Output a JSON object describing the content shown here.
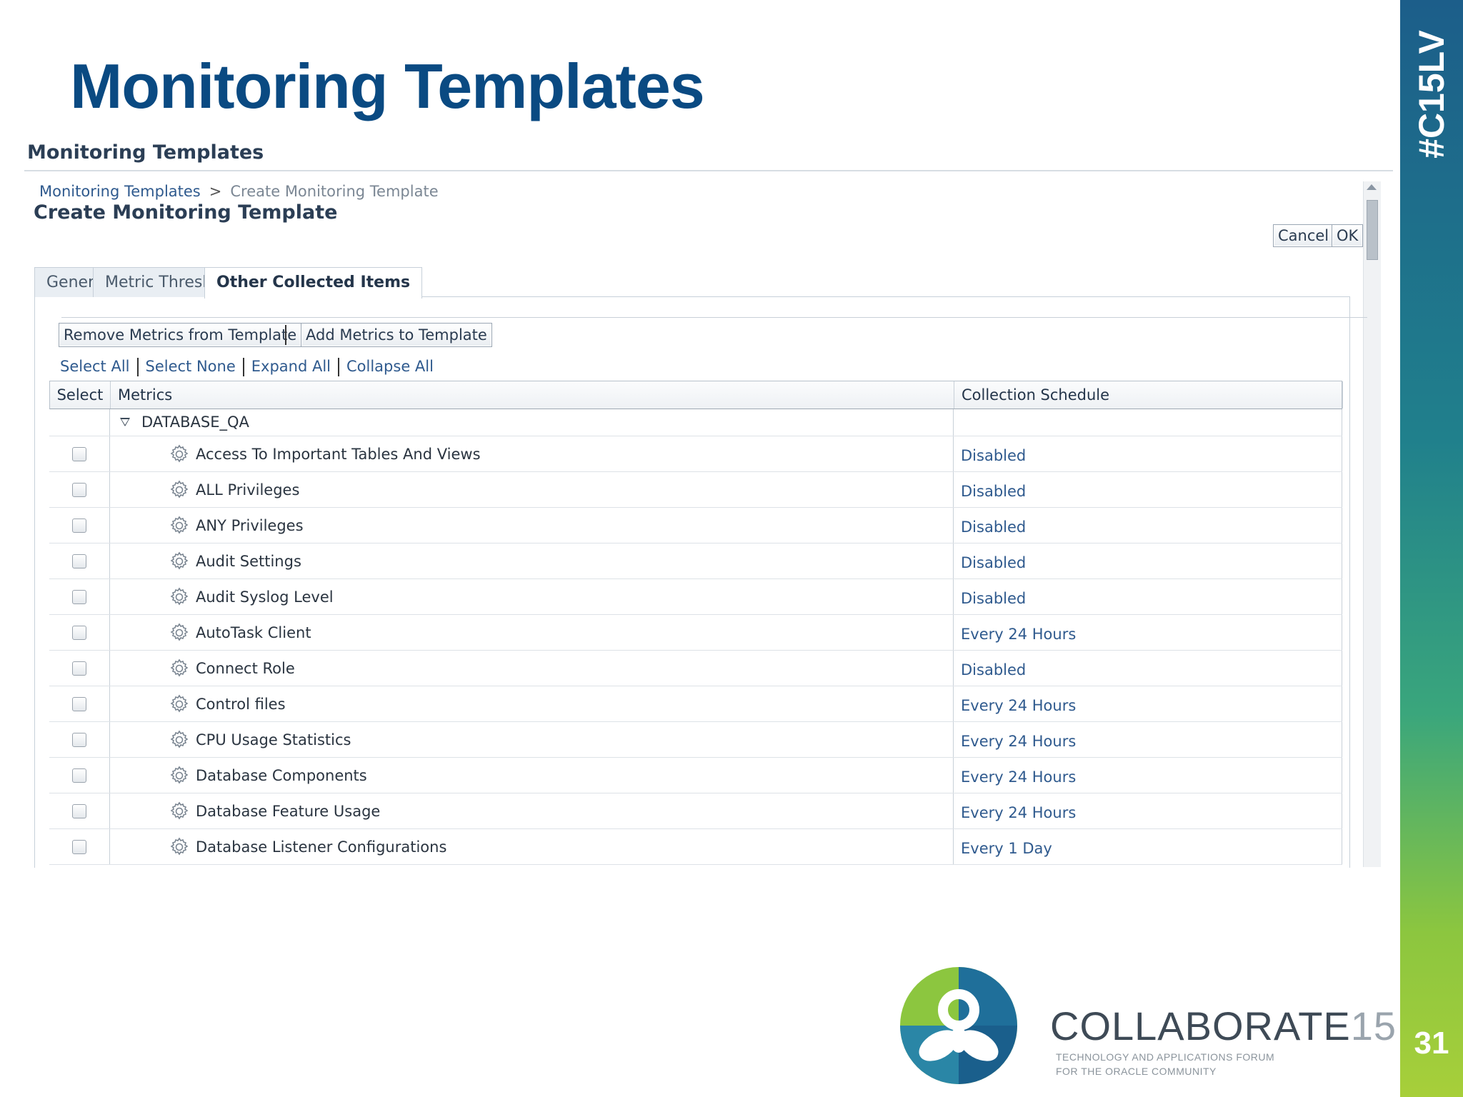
{
  "slide": {
    "title": "Monitoring Templates",
    "hashtag": "#C15LV",
    "page_number": "31",
    "colors": {
      "title": "#0a4a82",
      "brand_top": "#1c5e8a",
      "brand_bottom": "#a7cf3a"
    }
  },
  "app": {
    "header": "Monitoring Templates",
    "breadcrumb": {
      "link": "Monitoring Templates",
      "separator": ">",
      "current": "Create Monitoring Template"
    },
    "page_heading": "Create Monitoring Template",
    "buttons": {
      "cancel": "Cancel",
      "ok": "OK"
    },
    "tabs": [
      {
        "label": "General",
        "active": false
      },
      {
        "label": "Metric Thresholds",
        "active": false
      },
      {
        "label": "Other Collected Items",
        "active": true
      }
    ],
    "toolbar": {
      "remove": "Remove Metrics from Template",
      "add": "Add Metrics to Template"
    },
    "links": {
      "select_all": "Select All",
      "select_none": "Select None",
      "expand_all": "Expand All",
      "collapse_all": "Collapse All"
    },
    "table": {
      "columns": {
        "select": "Select",
        "metrics": "Metrics",
        "schedule": "Collection Schedule"
      },
      "group": "DATABASE_QA",
      "rows": [
        {
          "metric": "Access To Important Tables And Views",
          "schedule": "Disabled"
        },
        {
          "metric": "ALL Privileges",
          "schedule": "Disabled"
        },
        {
          "metric": "ANY Privileges",
          "schedule": "Disabled"
        },
        {
          "metric": "Audit Settings",
          "schedule": "Disabled"
        },
        {
          "metric": "Audit Syslog Level",
          "schedule": "Disabled"
        },
        {
          "metric": "AutoTask Client",
          "schedule": "Every 24 Hours"
        },
        {
          "metric": "Connect Role",
          "schedule": "Disabled"
        },
        {
          "metric": "Control files",
          "schedule": "Every 24 Hours"
        },
        {
          "metric": "CPU Usage Statistics",
          "schedule": "Every 24 Hours"
        },
        {
          "metric": "Database Components",
          "schedule": "Every 24 Hours"
        },
        {
          "metric": "Database Feature Usage",
          "schedule": "Every 24 Hours"
        },
        {
          "metric": "Database Listener Configurations",
          "schedule": "Every 1 Day"
        }
      ]
    }
  },
  "logo": {
    "wordmark": "COLLABORATE",
    "wordmark_num": "15",
    "tagline_1": "TECHNOLOGY AND APPLICATIONS FORUM",
    "tagline_2": "FOR THE ORACLE COMMUNITY"
  }
}
